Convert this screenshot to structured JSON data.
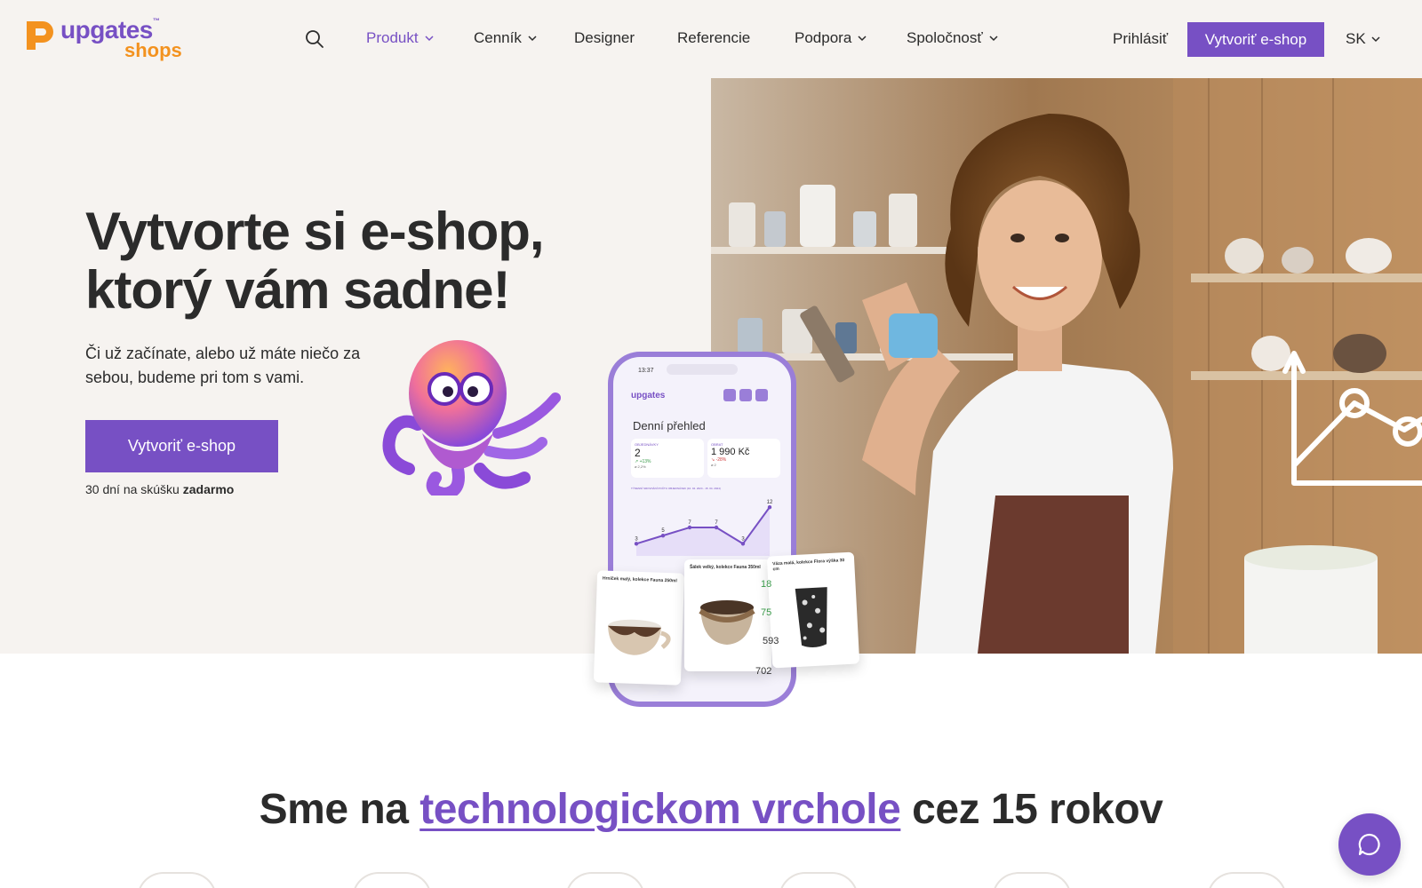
{
  "brand": {
    "name_top": "upgates",
    "name_bottom": "shops",
    "trademark": "™",
    "colors": {
      "purple": "#7750c4",
      "orange": "#f3921f",
      "text": "#2b2b2b",
      "hero_bg": "#f6f3f0"
    }
  },
  "nav": {
    "search_icon": "search-icon",
    "items": [
      {
        "label": "Produkt",
        "has_dropdown": true,
        "active": true
      },
      {
        "label": "Cenník",
        "has_dropdown": true,
        "active": false
      },
      {
        "label": "Designer",
        "has_dropdown": false,
        "active": false
      },
      {
        "label": "Referencie",
        "has_dropdown": false,
        "active": false
      },
      {
        "label": "Podpora",
        "has_dropdown": true,
        "active": false
      },
      {
        "label": "Spoločnosť",
        "has_dropdown": true,
        "active": false
      }
    ],
    "login": "Prihlásiť",
    "cta": "Vytvoriť e-shop",
    "language": "SK"
  },
  "hero": {
    "title_line1": "Vytvorte si e-shop,",
    "title_line2": "ktorý vám sadne!",
    "subtitle": "Či už začínate, alebo už máte niečo za sebou, budeme pri tom s vami.",
    "cta": "Vytvoriť e-shop",
    "trial_prefix": "30 dní na skúšku ",
    "trial_bold": "zadarmo"
  },
  "phone": {
    "time": "13:37",
    "app_title": "Denní přehled",
    "stat1_label": "OBJEDNÁVKY",
    "stat1_value": "2",
    "stat1_change": "↗ +13%",
    "stat1_avg": "⌀ 2,2%",
    "stat2_label": "OBRAT",
    "stat2_value": "1 990 Kč",
    "stat2_change": "↘ -28%",
    "stat2_avg": "⌀ 2",
    "chart_label": "TÝDENNÍ SROVNÁNÍ POČTU OBJEDNÁVEK (10. 04. 2024 - 15. 04. 2024)",
    "chart_points": [
      3,
      5,
      7,
      7,
      3,
      12
    ],
    "product_cards": [
      "Hrníček malý, kolekce Fauna 250ml",
      "Šálek velký, kolekce Fauna 350ml",
      "Váza malá, kolekce Flora výška 30 cm"
    ],
    "card_numbers": [
      "18",
      "75",
      "593",
      "702"
    ]
  },
  "section": {
    "title_before": "Sme na ",
    "title_highlight": "technologickom vrchole",
    "title_after": " cez 15 rokov"
  },
  "chat": {
    "icon": "chat-icon"
  }
}
